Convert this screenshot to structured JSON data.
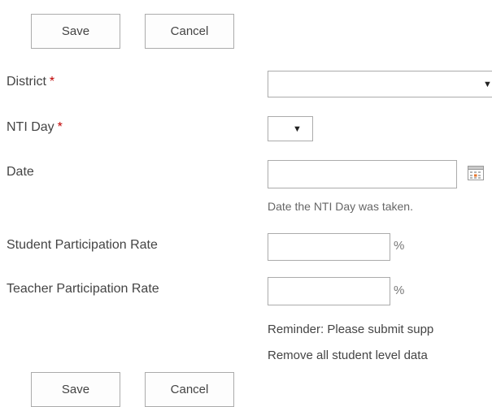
{
  "top_actions": {
    "save_label": "Save",
    "cancel_label": "Cancel"
  },
  "form": {
    "district": {
      "label": "District",
      "required_mark": "*",
      "value": ""
    },
    "nti_day": {
      "label": "NTI Day",
      "required_mark": "*",
      "value": ""
    },
    "date": {
      "label": "Date",
      "value": "",
      "hint": "Date the NTI Day was taken.",
      "icon": "calendar-icon"
    },
    "student_rate": {
      "label": "Student Participation Rate",
      "value": "",
      "unit": "%"
    },
    "teacher_rate": {
      "label": "Teacher Participation Rate",
      "value": "",
      "unit": "%"
    },
    "reminder_line1": "Reminder: Please submit supp",
    "reminder_line2": "Remove all student level data"
  },
  "bottom_actions": {
    "save_label": "Save",
    "cancel_label": "Cancel"
  },
  "colors": {
    "required": "#bf0000",
    "border": "#ababab",
    "text": "#444444"
  }
}
